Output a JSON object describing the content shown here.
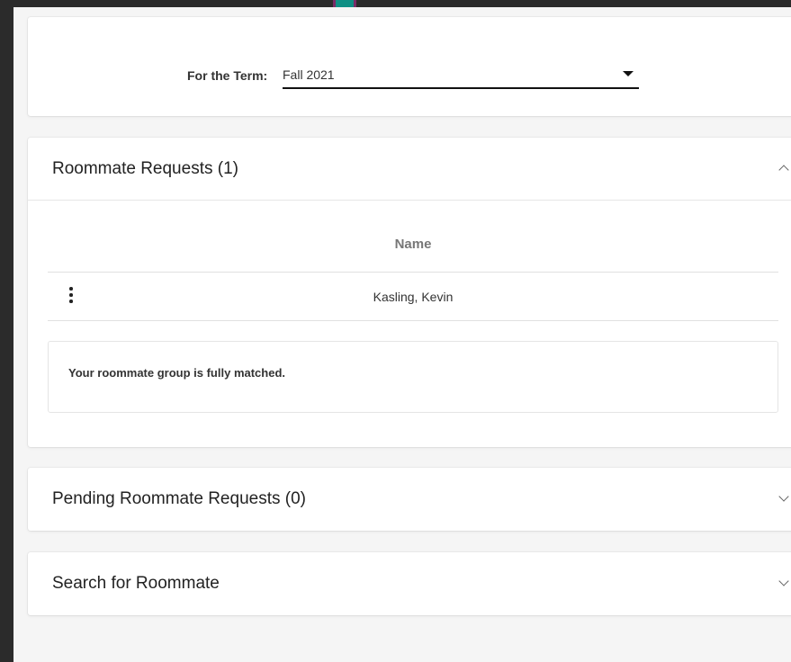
{
  "term": {
    "label": "For the Term:",
    "selected": "Fall 2021"
  },
  "roommate_requests": {
    "title": "Roommate Requests (1)",
    "expanded": true,
    "columns": [
      "Name"
    ],
    "rows": [
      {
        "name": "Kasling, Kevin"
      }
    ],
    "notice": "Your roommate group is fully matched."
  },
  "pending_requests": {
    "title": "Pending Roommate Requests (0)",
    "expanded": false
  },
  "search": {
    "title": "Search for Roommate",
    "expanded": false
  },
  "colors": {
    "page_background": "#f5f5f5",
    "frame": "#2b2b2b",
    "accent_teal": "#0f8f84",
    "accent_purple": "#7a2b66"
  }
}
